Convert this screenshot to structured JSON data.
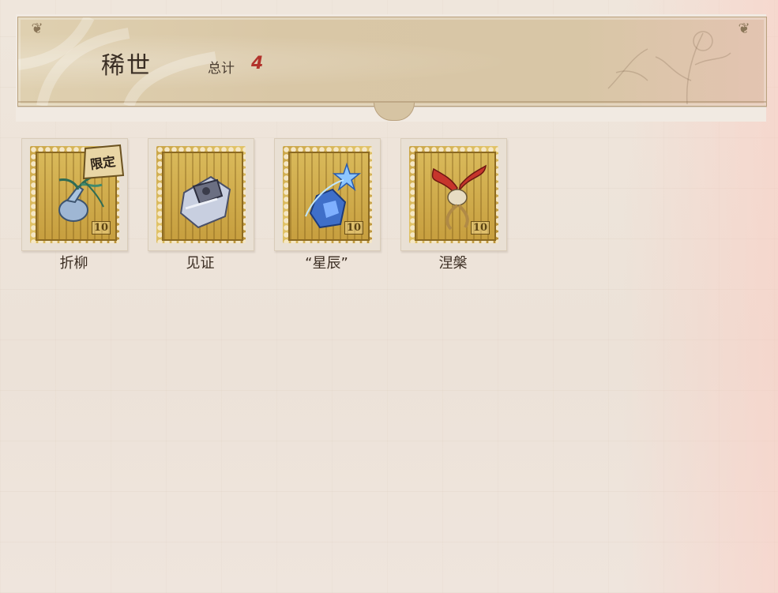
{
  "header": {
    "title": "稀世",
    "total_label": "总计",
    "total_count": "4"
  },
  "items": [
    {
      "name": "折柳",
      "limited": true,
      "badge": "限定",
      "denomination": "10",
      "icon": "willow-vase-icon"
    },
    {
      "name": "见证",
      "limited": false,
      "denomination": "",
      "icon": "crystal-box-icon"
    },
    {
      "name": "“星辰”",
      "limited": false,
      "denomination": "10",
      "icon": "star-bottle-icon"
    },
    {
      "name": "涅槃",
      "limited": false,
      "denomination": "10",
      "icon": "phoenix-icon"
    }
  ],
  "colors": {
    "count_red": "#b2332c",
    "stamp_gold": "#d2b14f",
    "text_dark": "#3b2d22"
  }
}
